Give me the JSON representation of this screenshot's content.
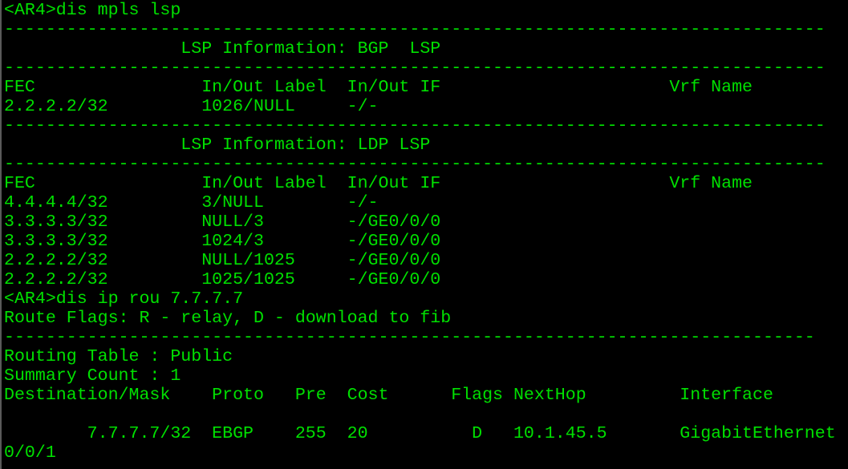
{
  "terminal": {
    "text_color": "#00e000",
    "background": "#000000",
    "lines": [
      "<AR4>dis mpls lsp",
      "-------------------------------------------------------------------------------",
      "                 LSP Information: BGP  LSP",
      "-------------------------------------------------------------------------------",
      "FEC                In/Out Label  In/Out IF                      Vrf Name",
      "2.2.2.2/32         1026/NULL     -/-",
      "-------------------------------------------------------------------------------",
      "                 LSP Information: LDP LSP",
      "-------------------------------------------------------------------------------",
      "FEC                In/Out Label  In/Out IF                      Vrf Name",
      "4.4.4.4/32         3/NULL        -/-",
      "3.3.3.3/32         NULL/3        -/GE0/0/0",
      "3.3.3.3/32         1024/3        -/GE0/0/0",
      "2.2.2.2/32         NULL/1025     -/GE0/0/0",
      "2.2.2.2/32         1025/1025     -/GE0/0/0",
      "<AR4>dis ip rou 7.7.7.7",
      "Route Flags: R - relay, D - download to fib",
      "------------------------------------------------------------------------------",
      "Routing Table : Public",
      "Summary Count : 1",
      "Destination/Mask    Proto   Pre  Cost      Flags NextHop         Interface",
      "",
      "        7.7.7.7/32  EBGP    255  20          D   10.1.45.5       GigabitEthernet",
      "0/0/1"
    ]
  },
  "session": {
    "device_prompt": "<AR4>",
    "commands": [
      "dis mpls lsp",
      "dis ip rou 7.7.7.7"
    ]
  },
  "mpls_lsp": {
    "bgp_lsp": {
      "title": "LSP Information: BGP  LSP",
      "columns": [
        "FEC",
        "In/Out Label",
        "In/Out IF",
        "Vrf Name"
      ],
      "rows": [
        [
          "2.2.2.2/32",
          "1026/NULL",
          "-/-",
          ""
        ]
      ]
    },
    "ldp_lsp": {
      "title": "LSP Information: LDP LSP",
      "columns": [
        "FEC",
        "In/Out Label",
        "In/Out IF",
        "Vrf Name"
      ],
      "rows": [
        [
          "4.4.4.4/32",
          "3/NULL",
          "-/-",
          ""
        ],
        [
          "3.3.3.3/32",
          "NULL/3",
          "-/GE0/0/0",
          ""
        ],
        [
          "3.3.3.3/32",
          "1024/3",
          "-/GE0/0/0",
          ""
        ],
        [
          "2.2.2.2/32",
          "NULL/1025",
          "-/GE0/0/0",
          ""
        ],
        [
          "2.2.2.2/32",
          "1025/1025",
          "-/GE0/0/0",
          ""
        ]
      ]
    }
  },
  "ip_routing": {
    "route_flags": "Route Flags: R - relay, D - download to fib",
    "routing_table": "Public",
    "summary_count": "1",
    "columns": [
      "Destination/Mask",
      "Proto",
      "Pre",
      "Cost",
      "Flags",
      "NextHop",
      "Interface"
    ],
    "rows": [
      [
        "7.7.7.7/32",
        "EBGP",
        "255",
        "20",
        "D",
        "10.1.45.5",
        "GigabitEthernet0/0/1"
      ]
    ]
  }
}
